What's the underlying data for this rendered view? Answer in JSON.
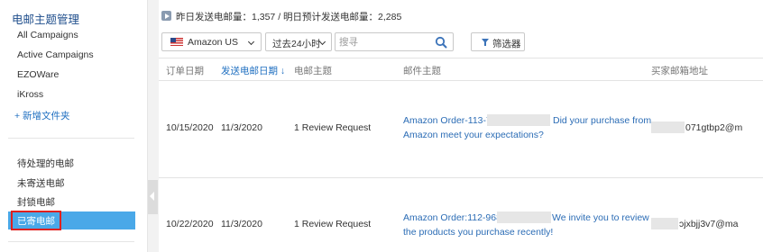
{
  "sidebar": {
    "title": "电邮主题管理",
    "campaigns": [
      "All Campaigns",
      "Active Campaigns",
      "EZOWare",
      "iKross"
    ],
    "new_folder": "+ 新增文件夹",
    "mail_items": [
      "待处理的电邮",
      "未寄送电邮",
      "封锁电邮"
    ],
    "active_item": "已寄电邮"
  },
  "stats": {
    "text": "昨日发送电邮量：1,357 / 明日预计发送电邮量：2,285"
  },
  "toolbar": {
    "country": "Amazon US",
    "time_range": "过去24小时",
    "search_placeholder": "搜寻",
    "filter_label": "筛选器"
  },
  "table": {
    "columns": [
      "订单日期",
      "发送电邮日期 ↓",
      "电邮主题",
      "邮件主题",
      "买家邮箱地址"
    ],
    "rows": [
      {
        "order_date": "10/15/2020",
        "send_date": "11/3/2020",
        "email_topic": "1 Review Request",
        "subject_line1_start": "Amazon Order-113-70",
        "subject_line1_end": "Did your purchase from",
        "subject_line2": "Amazon meet your expectations?",
        "buyer_email_partial": "071gtbp2@m"
      },
      {
        "order_date": "10/22/2020",
        "send_date": "11/3/2020",
        "email_topic": "1 Review Request",
        "subject_line1_start": "Amazon Order:112-9681",
        "subject_line1_end": "We invite you to review",
        "subject_line2": "the products you purchase recently!",
        "buyer_email_partial": "ɔjxbjj3v7@ma"
      }
    ]
  },
  "colors": {
    "accent": "#4aa8e8",
    "link": "#2b6cb5",
    "highlight_border": "#e0201e"
  }
}
